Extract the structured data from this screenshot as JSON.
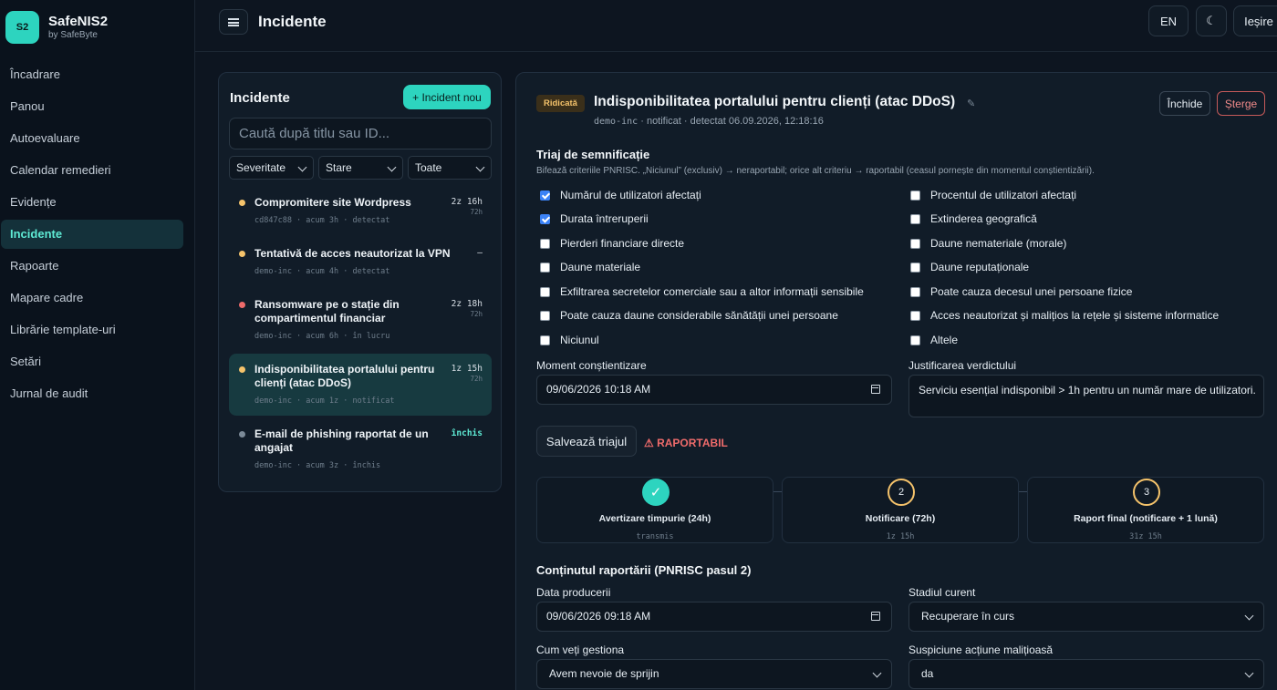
{
  "brand": {
    "logo": "S2",
    "name": "SafeNIS2",
    "sub": "by SafeByte"
  },
  "nav": [
    {
      "label": "Încadrare",
      "active": false
    },
    {
      "label": "Panou",
      "active": false
    },
    {
      "label": "Autoevaluare",
      "active": false
    },
    {
      "label": "Calendar remedieri",
      "active": false
    },
    {
      "label": "Evidențe",
      "active": false
    },
    {
      "label": "Incidente",
      "active": true
    },
    {
      "label": "Rapoarte",
      "active": false
    },
    {
      "label": "Mapare cadre",
      "active": false
    },
    {
      "label": "Librărie template-uri",
      "active": false
    },
    {
      "label": "Setări",
      "active": false
    },
    {
      "label": "Jurnal de audit",
      "active": false
    }
  ],
  "header": {
    "title": "Incidente",
    "lang": "EN",
    "theme_icon": "☾",
    "logout": "Ieșire"
  },
  "list": {
    "title": "Incidente",
    "new_button": "+ Incident nou",
    "search_placeholder": "Caută după titlu sau ID...",
    "filters": {
      "severity": "Severitate",
      "status": "Stare",
      "all": "Toate"
    },
    "items": [
      {
        "title": "Compromitere site Wordpress",
        "meta": "cd847c88 · acum 3h · detectat",
        "time": "2z 16h",
        "sub": "72h",
        "dot": "#f5c36b"
      },
      {
        "title": "Tentativă de acces neautorizat la VPN",
        "meta": "demo-inc · acum 4h · detectat",
        "time": "–",
        "sub": "",
        "dot": "#f5c36b"
      },
      {
        "title": "Ransomware pe o stație din compartimentul financiar",
        "meta": "demo-inc · acum 6h · în lucru",
        "time": "2z 18h",
        "sub": "72h",
        "dot": "#ef6b6b"
      },
      {
        "title": "Indisponibilitatea portalului pentru clienți (atac DDoS)",
        "meta": "demo-inc · acum 1z · notificat",
        "time": "1z 15h",
        "sub": "72h",
        "dot": "#f5c36b"
      },
      {
        "title": "E-mail de phishing raportat de un angajat",
        "meta": "demo-inc · acum 3z · închis",
        "time": "închis",
        "sub": "",
        "dot": "#7c8a98"
      }
    ]
  },
  "detail": {
    "badge": "Ridicată",
    "title": "Indisponibilitatea portalului pentru clienți (atac DDoS)",
    "meta_id": "demo-inc",
    "meta_rest": " · notificat · detectat 06.09.2026, 12:18:16",
    "close": "Închide",
    "delete": "Șterge",
    "triage_title": "Triaj de semnificație",
    "triage_desc": "Bifează criteriile PNRISC. „Niciunul” (exclusiv) → neraportabil; orice alt criteriu → raportabil (ceasul pornește din momentul conștientizării).",
    "criteria_left": [
      {
        "label": "Numărul de utilizatori afectați",
        "checked": true
      },
      {
        "label": "Durata întreruperii",
        "checked": true
      },
      {
        "label": "Pierderi financiare directe",
        "checked": false
      },
      {
        "label": "Daune materiale",
        "checked": false
      },
      {
        "label": "Exfiltrarea secretelor comerciale sau a altor informații sensibile",
        "checked": false
      },
      {
        "label": "Poate cauza daune considerabile sănătății unei persoane",
        "checked": false
      },
      {
        "label": "Niciunul",
        "checked": false
      }
    ],
    "criteria_right": [
      {
        "label": "Procentul de utilizatori afectați",
        "checked": false
      },
      {
        "label": "Extinderea geografică",
        "checked": false
      },
      {
        "label": "Daune nemateriale (morale)",
        "checked": false
      },
      {
        "label": "Daune reputaționale",
        "checked": false
      },
      {
        "label": "Poate cauza decesul unei persoane fizice",
        "checked": false
      },
      {
        "label": "Acces neautorizat și malițios la rețele și sisteme informatice",
        "checked": false
      },
      {
        "label": "Altele",
        "checked": false
      }
    ],
    "awareness_label": "Moment conștientizare",
    "awareness_value": "09/06/2026  10:18  AM",
    "justification_label": "Justificarea verdictului",
    "justification_value": "Serviciu esențial indisponibil > 1h pentru un număr mare de utilizatori.",
    "save_button": "Salvează triajul",
    "verdict": "⚠ RAPORTABIL",
    "steps": [
      {
        "marker": "✓",
        "name": "Avertizare timpurie (24h)",
        "status": "transmis",
        "done": true
      },
      {
        "marker": "2",
        "name": "Notificare (72h)",
        "status": "1z 15h",
        "done": false
      },
      {
        "marker": "3",
        "name": "Raport final (notificare + 1 lună)",
        "status": "31z 15h",
        "done": false
      }
    ],
    "report_title": "Conținutul raportării (PNRISC pasul 2)",
    "occurrence_label": "Data producerii",
    "occurrence_value": "09/06/2026  09:18  AM",
    "stage_label": "Stadiul curent",
    "stage_value": "Recuperare în curs",
    "handle_label": "Cum veți gestiona",
    "handle_value": "Avem nevoie de sprijin",
    "malicious_label": "Suspiciune acțiune malițioasă",
    "malicious_value": "da"
  }
}
